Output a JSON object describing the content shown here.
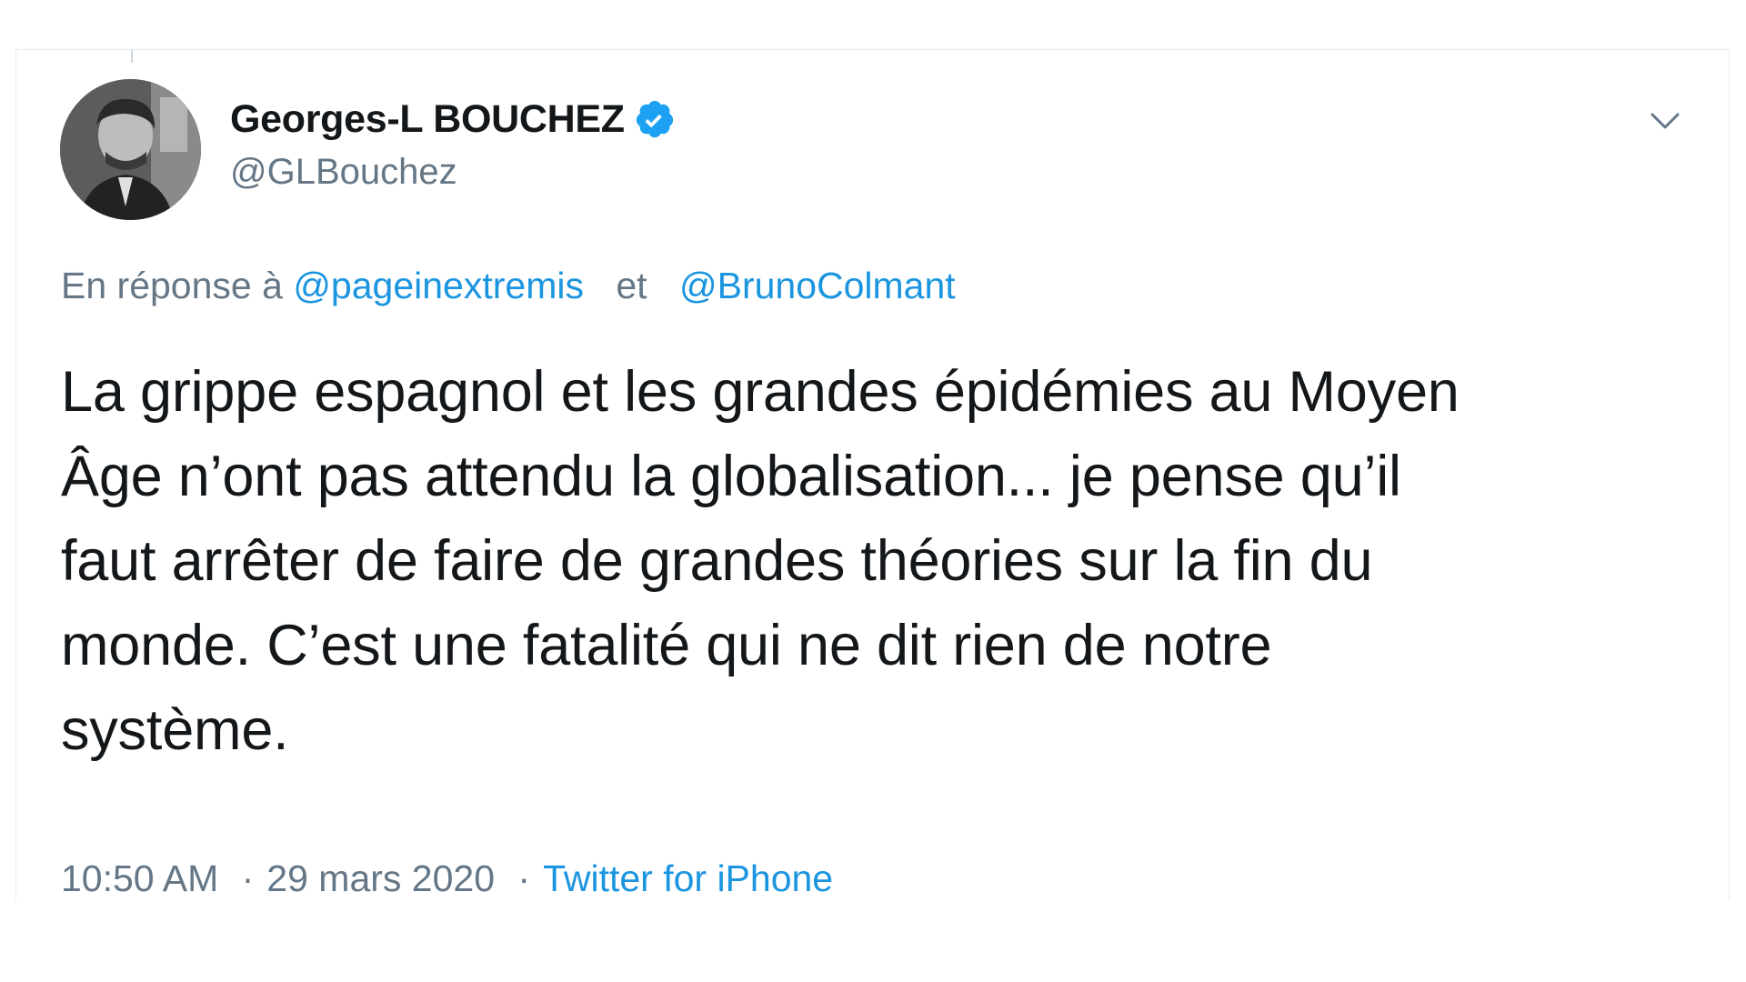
{
  "tweet": {
    "author": {
      "display_name": "Georges-L BOUCHEZ",
      "handle": "@GLBouchez",
      "verified": true
    },
    "reply_to": {
      "prefix": "En réponse à",
      "mentions": [
        "@pageinextremis",
        "@BrunoColmant"
      ],
      "conjunction": "et"
    },
    "text_lines": [
      "La grippe espagnol et les grandes épidémies au Moyen",
      "Âge n’ont pas attendu la globalisation... je pense qu’il",
      "faut arrêter de faire de grandes théories sur la fin du",
      "monde. C’est une fatalité qui ne dit rien de notre",
      "système."
    ],
    "time": "10:50 AM",
    "separator": "·",
    "date": "29 mars 2020",
    "source": "Twitter for iPhone"
  },
  "icons": {
    "verified": "verified-badge-icon",
    "menu": "chevron-down-icon"
  },
  "colors": {
    "accent": "#1b95e0",
    "secondary_text": "#657786",
    "primary_text": "#14171a",
    "border": "#e6ecf0"
  }
}
